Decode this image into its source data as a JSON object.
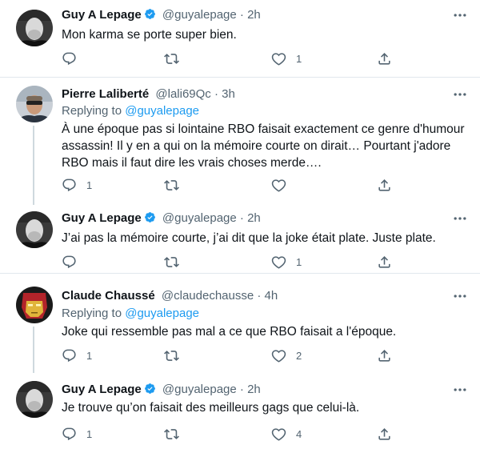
{
  "tweets": [
    {
      "name": "Guy A Lepage",
      "verified": true,
      "handle": "@guyalepage",
      "dot": "·",
      "time": "2h",
      "replying_label": "",
      "replying_to": "",
      "text": "Mon karma se porte super bien.",
      "reply_count": "",
      "retweet_count": "",
      "like_count": "1"
    },
    {
      "name": "Pierre Laliberté",
      "verified": false,
      "handle": "@lali69Qc",
      "dot": "·",
      "time": "3h",
      "replying_label": "Replying to ",
      "replying_to": "@guyalepage",
      "text": "À une époque pas si lointaine RBO faisait exactement ce genre d'humour assassin! Il y en a qui on la mémoire courte on dirait… Pourtant j'adore RBO mais il faut dire les vrais choses merde….",
      "reply_count": "1",
      "retweet_count": "",
      "like_count": ""
    },
    {
      "name": "Guy A Lepage",
      "verified": true,
      "handle": "@guyalepage",
      "dot": "·",
      "time": "2h",
      "replying_label": "",
      "replying_to": "",
      "text": "J’ai pas la mémoire courte, j’ai dit que la joke était plate. Juste plate.",
      "reply_count": "",
      "retweet_count": "",
      "like_count": "1"
    },
    {
      "name": "Claude Chaussé",
      "verified": false,
      "handle": "@claudechausse",
      "dot": "·",
      "time": "4h",
      "replying_label": "Replying to ",
      "replying_to": "@guyalepage",
      "text": "Joke qui ressemble pas mal a ce que RBO faisait a l'époque.",
      "reply_count": "1",
      "retweet_count": "",
      "like_count": "2"
    },
    {
      "name": "Guy A Lepage",
      "verified": true,
      "handle": "@guyalepage",
      "dot": "·",
      "time": "2h",
      "replying_label": "",
      "replying_to": "",
      "text": "Je trouve qu’on faisait des meilleurs gags que celui-là.",
      "reply_count": "1",
      "retweet_count": "",
      "like_count": "4"
    }
  ],
  "icons": {
    "reply": "reply-icon",
    "retweet": "retweet-icon",
    "like": "like-icon",
    "share": "share-icon",
    "verified": "verified-badge-icon",
    "more": "more-options-icon"
  },
  "colors": {
    "link": "#1d9bf0",
    "muted": "#536471",
    "text": "#0f1419",
    "thread_line": "#cfd9de",
    "divider": "#e1e8ed"
  }
}
